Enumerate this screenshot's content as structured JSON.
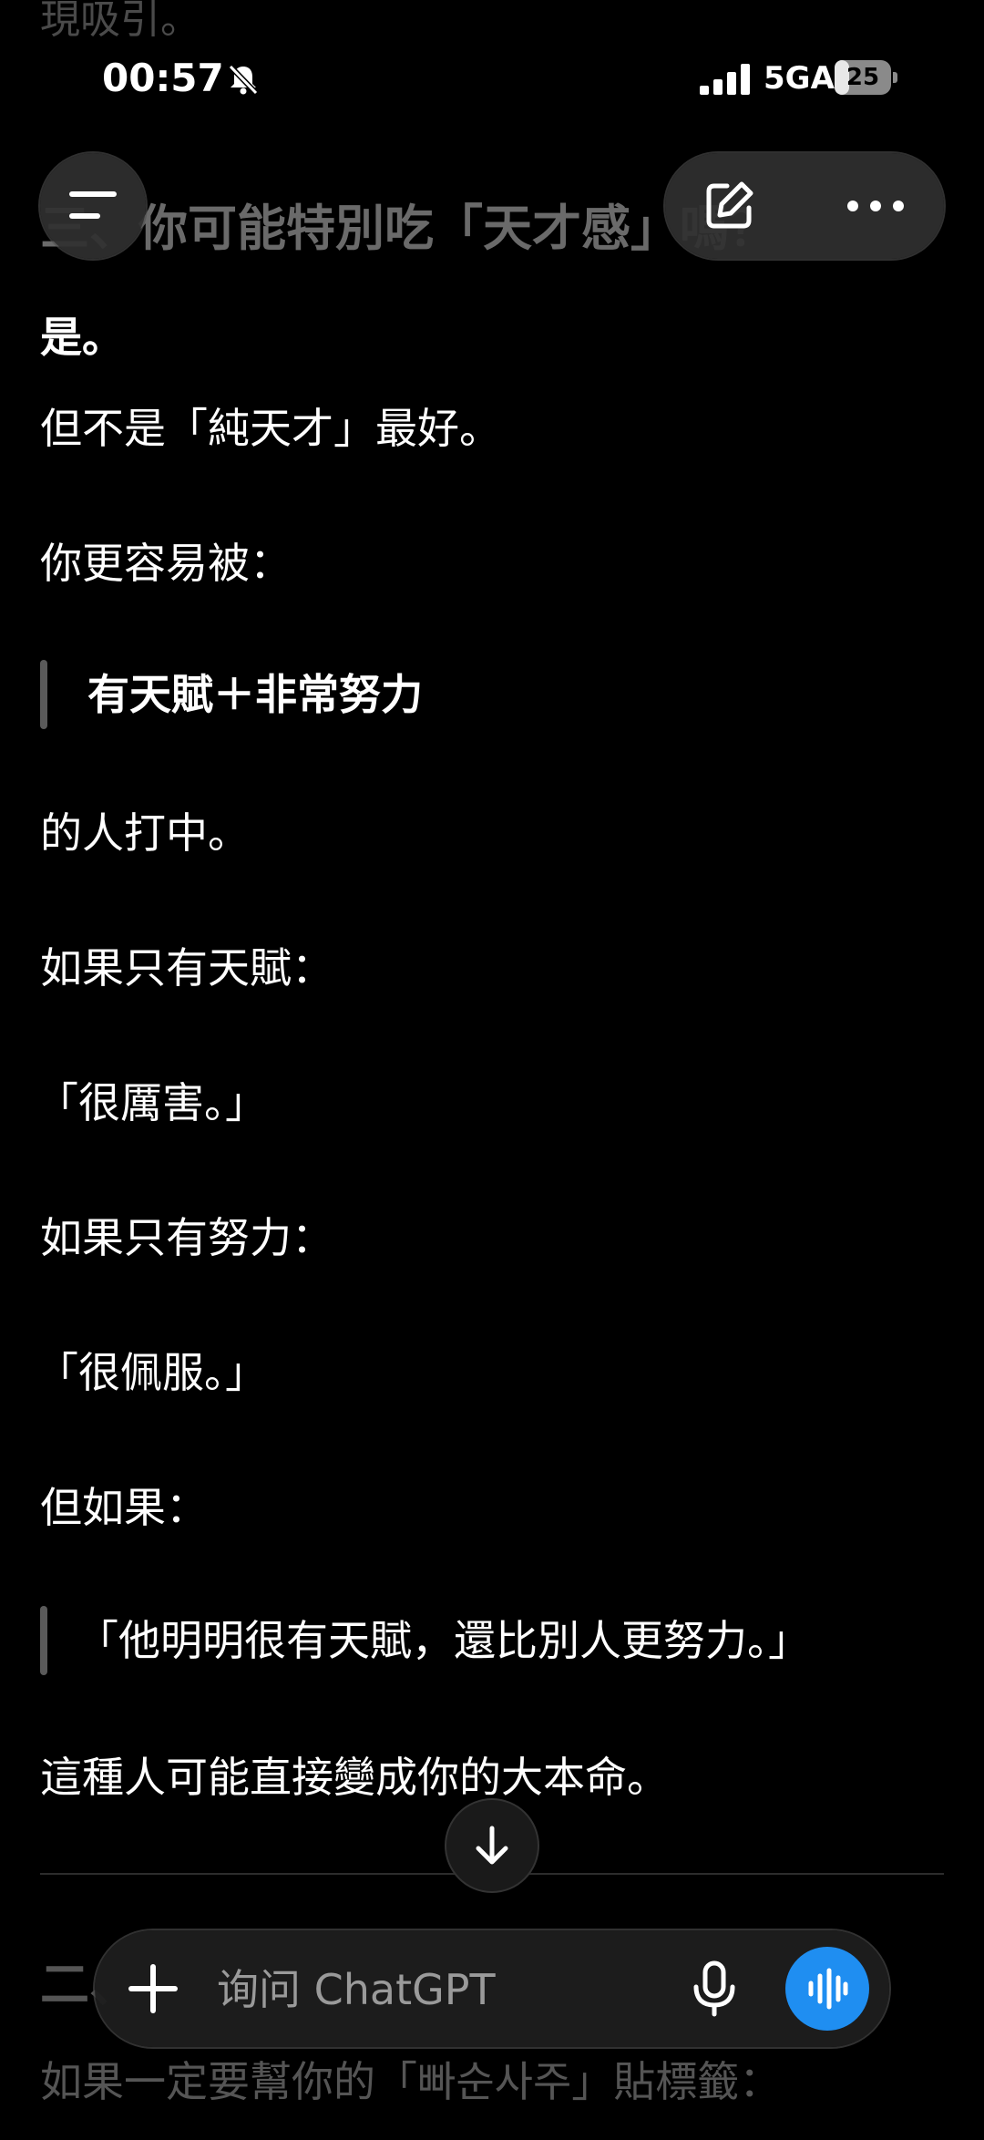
{
  "status_bar": {
    "time": "00:57",
    "network": "5GA",
    "battery_text": "25",
    "battery_level_percent": 25,
    "icons": [
      "bell-muted-icon",
      "signal-icon",
      "battery-icon"
    ]
  },
  "header": {
    "faded_top_text": "現吸引。",
    "section_title": "三、你可能特別吃「天才感」嗎？",
    "menu_icon": "hamburger-menu-icon",
    "compose_icon": "new-chat-icon",
    "more_icon": "more-options-icon"
  },
  "content": {
    "lines": [
      "是。",
      "但不是「純天才」最好。",
      "你更容易被：",
      "有天賦＋非常努力",
      "的人打中。",
      "如果只有天賦：",
      "「很厲害。」",
      "如果只有努力：",
      "「很佩服。」",
      "但如果：",
      "「他明明很有天賦，還比別人更努力。」",
      "這種人可能直接變成你的大本命。"
    ],
    "next_section_title": "二、",
    "next_section_line": "如果一定要幫你的「빠순사주」貼標籤："
  },
  "composer": {
    "placeholder": "询问 ChatGPT",
    "plus_icon": "plus-icon",
    "mic_icon": "microphone-icon",
    "voice_icon": "voice-waveform-icon",
    "accent_color": "#1f8ef1"
  },
  "scroll_button_icon": "arrow-down-icon"
}
